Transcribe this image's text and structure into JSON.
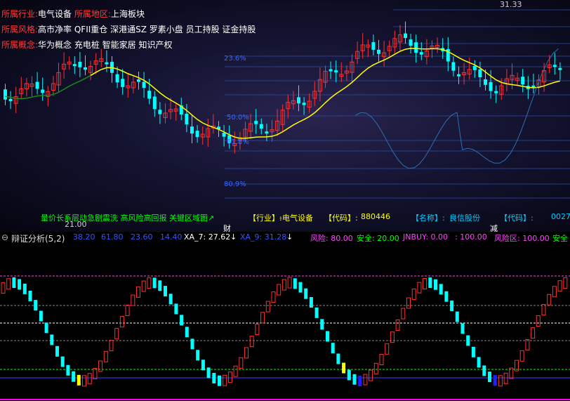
{
  "info": {
    "industry_label": "所属行业:",
    "industry_value": "电气设备",
    "region_label": "所属地区:",
    "region_value": "上海板块",
    "style_label": "所属风格:",
    "style_value": "高市净率 QFII重仓 深港通SZ 罗素小盘 员工持股 证金持股",
    "concept_label": "所属概念:",
    "concept_value": "华为概念 充电桩 智能家居 知识产权"
  },
  "main_chart": {
    "high_label": "31.33",
    "low_label": "21.00",
    "pct_labels": [
      "23.6%",
      "50.0%",
      "61.8%",
      "80.9%"
    ],
    "marker_cai": "财",
    "marker_jian": "减",
    "colors": {
      "up": "#ff3030",
      "down": "#00ffff",
      "ma_yellow": "#ffff00",
      "ma_green": "#1a8a1a",
      "band": "#2a4aa0"
    }
  },
  "status_bar": {
    "text_left": "量价长系层动急剧震洗 高风险高回报 关键区域图↗",
    "industry_tag": "【行业】:",
    "industry_val": "-电气设备",
    "code_tag": "【代码】:",
    "code_val": "880446",
    "name_tag": "【名称】:",
    "name_val": "良信股份",
    "code2_tag": "【代码】:",
    "code2_val": "0027"
  },
  "indicator": {
    "title": "辩证分析(5,2)",
    "values": [
      "38.20",
      "61.80",
      "23.60",
      "14.40"
    ],
    "xa7": "XA_7: 27.62",
    "xa9": "XA_9: 31.28",
    "risk": "风险: 80.00",
    "safe": "安全: 20.00",
    "jnbuy": "JNBUY: 0.00",
    "hundred": ": 100.00",
    "risk_zone": "风险区: 100.00",
    "safe2": "安全"
  }
}
